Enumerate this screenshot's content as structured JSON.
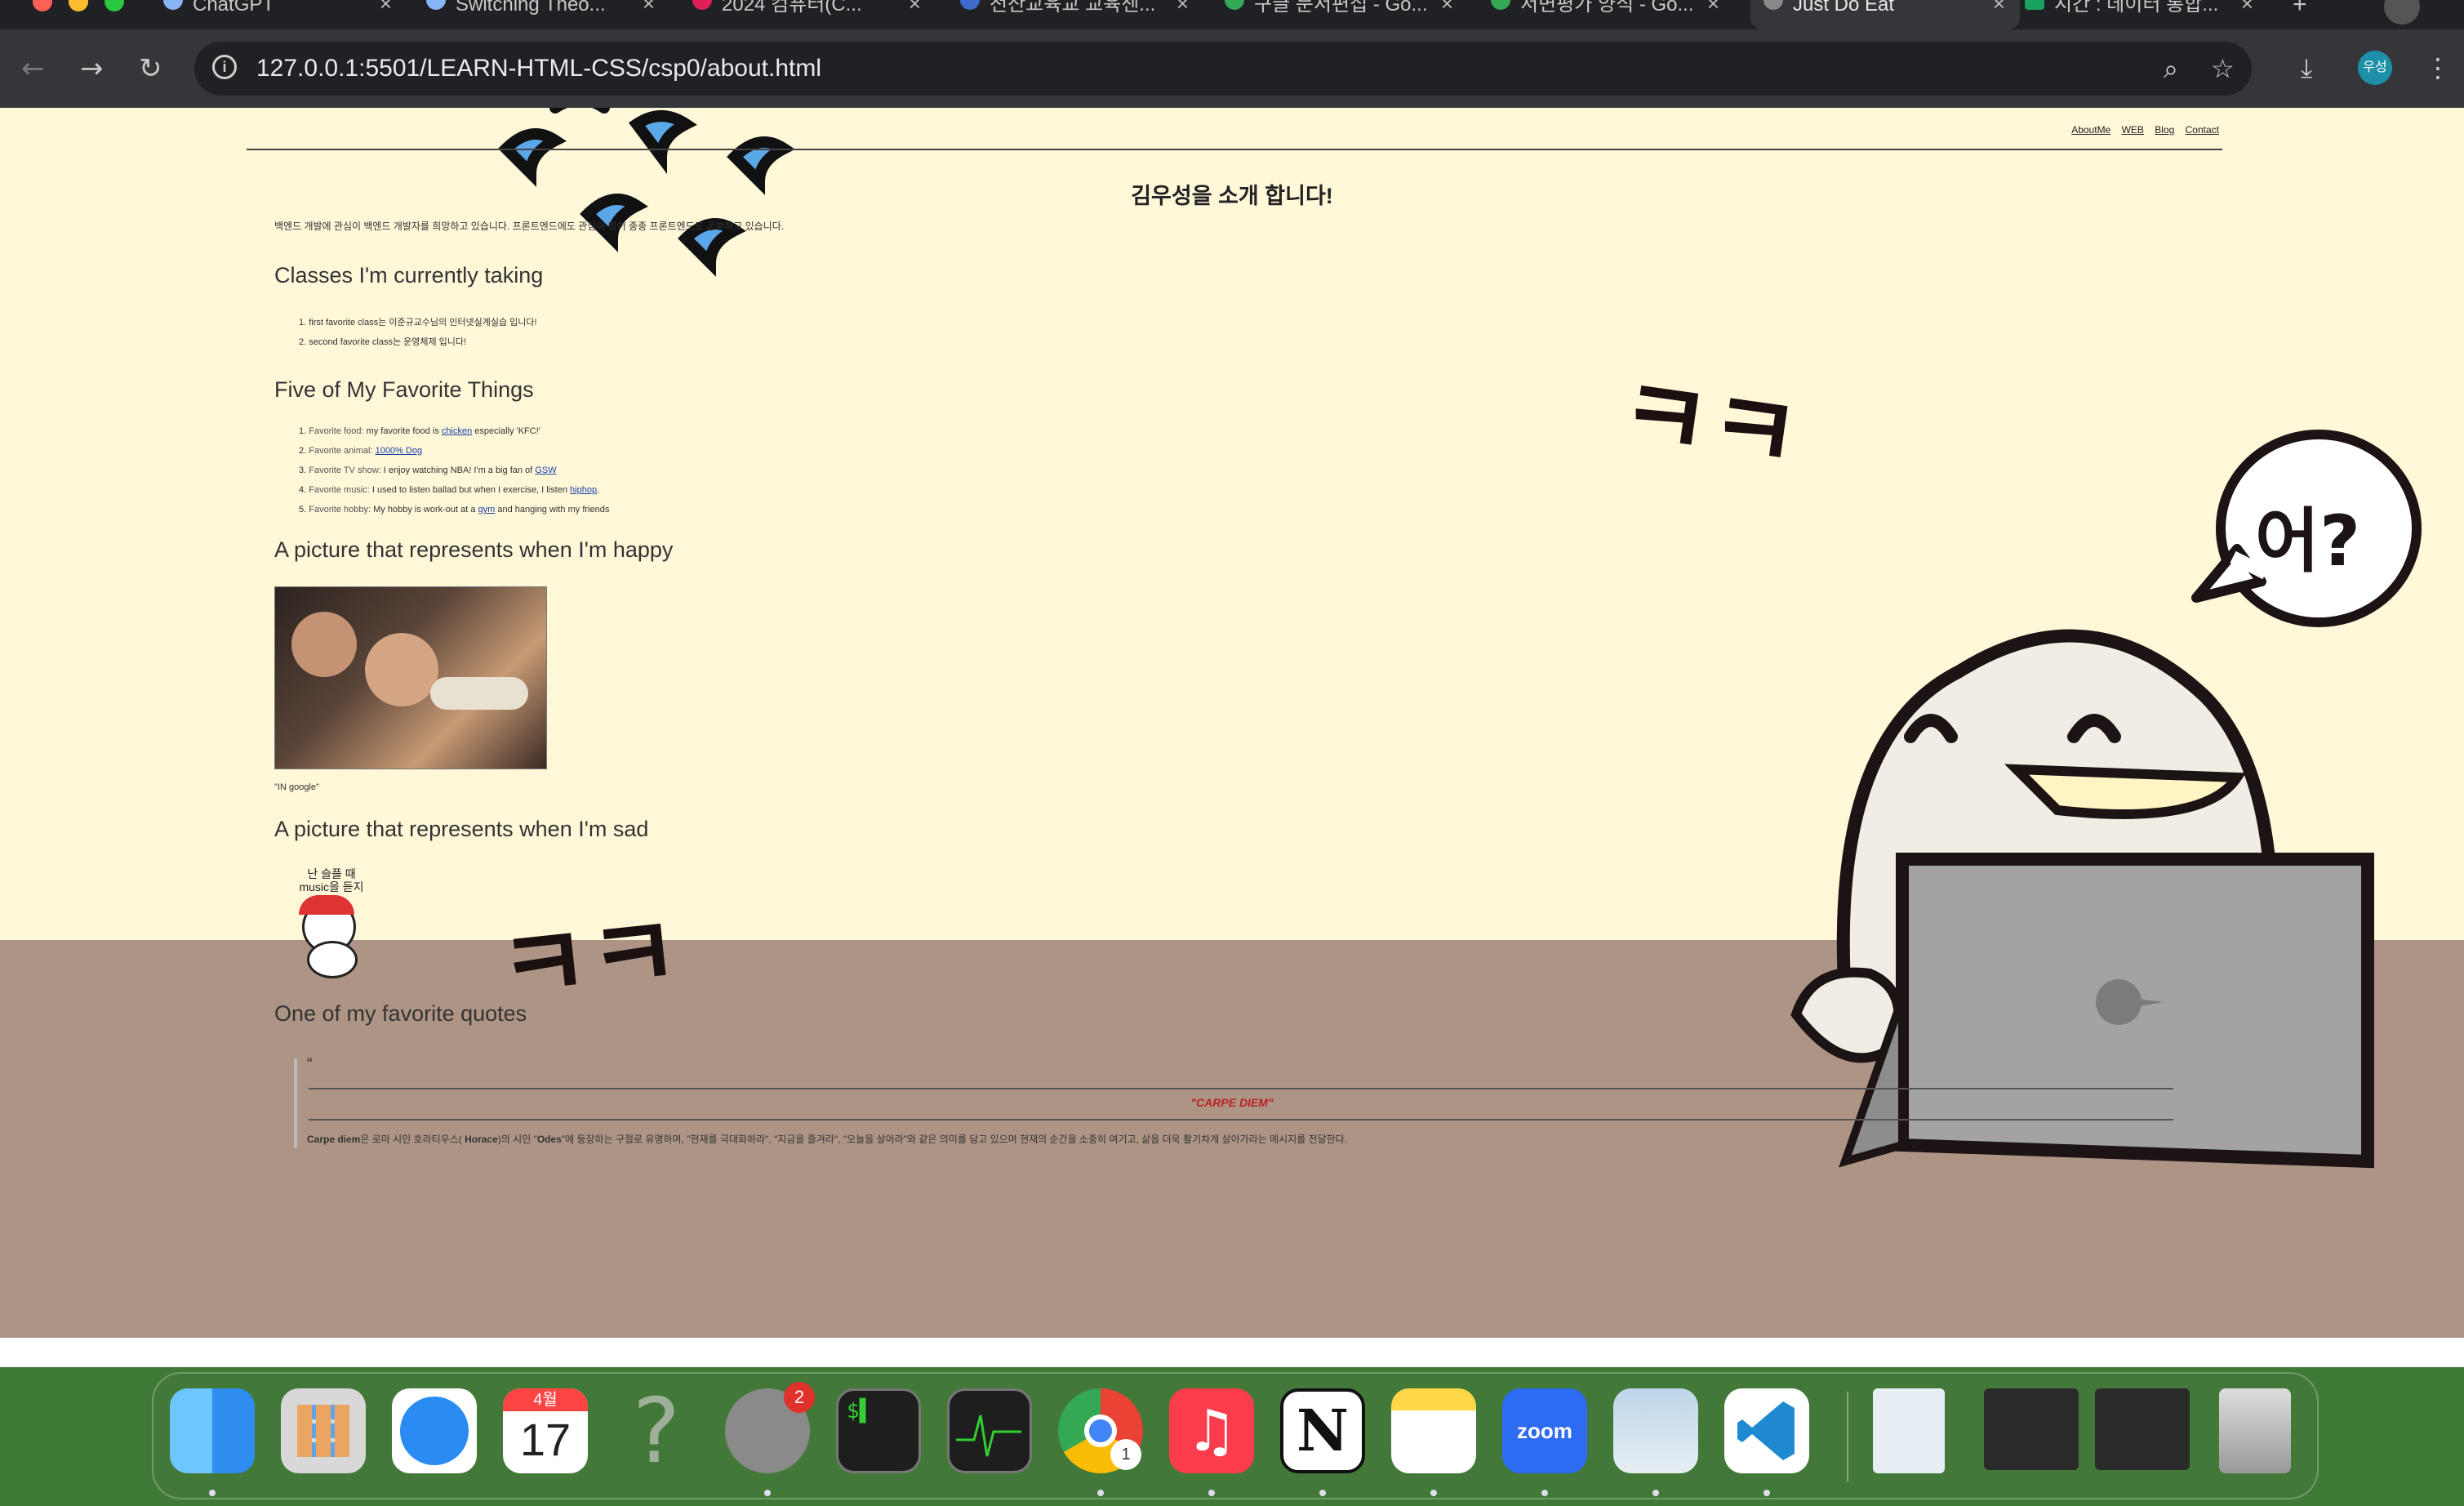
{
  "browser": {
    "tabs": [
      {
        "title": "ChatGPT",
        "active": false
      },
      {
        "title": "Switching Theo...",
        "active": false
      },
      {
        "title": "2024 컴퓨터(C...",
        "active": false
      },
      {
        "title": "전산교육교 교육센...",
        "active": false
      },
      {
        "title": "구글 문서편집 - Go...",
        "active": false
      },
      {
        "title": "서면평가 양식 - Go...",
        "active": false
      },
      {
        "title": "Just Do Eat",
        "active": true
      },
      {
        "title": "시간 : 데이터 통합...",
        "active": false
      }
    ],
    "url": "127.0.0.1:5501/LEARN-HTML-CSS/csp0/about.html",
    "profile_initials": "우성"
  },
  "page": {
    "nav": [
      "AboutMe",
      "WEB",
      "Blog",
      "Contact"
    ],
    "heading": "김우성을 소개 합니다!",
    "intro": "백엔드 개발에 관심이 백엔드 개발자를 희망하고 있습니다. 프론트엔드에도 관심이 있어 종종 프론트엔드도 공부하고 있습니다.",
    "classes_title": "Classes I'm currently taking",
    "classes": [
      "1. first favorite class는 이준규교수님의 인터넷실계실습 입니다!",
      "2. second favorite class는 운영체제 입니다!"
    ],
    "favorites_title": "Five of My Favorite Things",
    "favorites": [
      {
        "num": "1.",
        "label": "Favorite food:",
        "text_before": " my favorite food is ",
        "link": "chicken",
        "text_after": " especially 'KFC!'"
      },
      {
        "num": "2.",
        "label": "Favorite animal:",
        "text_before": " ",
        "link": "1000% Dog",
        "text_after": ""
      },
      {
        "num": "3.",
        "label": "Favorite TV show:",
        "text_before": " I enjoy watching NBA! I'm a big fan of ",
        "link": "GSW",
        "text_after": ""
      },
      {
        "num": "4.",
        "label": "Favorite music:",
        "text_before": " I used to listen ballad but when I exercise, I listen ",
        "link": "hiphop",
        "text_after": "."
      },
      {
        "num": "5.",
        "label": "Favorite hobby:",
        "text_before": " My hobby is work-out at a ",
        "link": "gym",
        "text_after": " and hanging with my friends"
      }
    ],
    "happy_title": "A picture that represents when I'm happy",
    "happy_caption": "\"IN google\"",
    "sad_title": "A picture that represents when I'm sad",
    "sad_sticker_text": "난 슬플 때\nmusic을 듣지",
    "quote_title_section": "One of my favorite quotes",
    "quote_mark": "“",
    "quote_title": "\"CARPE DIEM\"",
    "quote_text_bold1": "Carpe diem",
    "quote_text_1": "은 로마 시인 호라티우스( ",
    "quote_text_bold2": "Horace",
    "quote_text_2": ")의 시인 \"",
    "quote_text_bold3": "Odes",
    "quote_text_3": "\"에 등장하는 구절로 유명하며, \"현재를 극대화하라\", \"지금을 즐겨라\", \"오늘을 살아라\"와 같은 의미를 담고 있으며 현재의 순간을 소중히 여기고, 삶을 더욱 활기차게 살아가라는 메시지를 전달한다.",
    "bubble_text": "어?",
    "doodle_1": "ㅋㅋ",
    "doodle_2": "ㅋㅋ"
  },
  "dock": {
    "apps": [
      {
        "name": "Finder",
        "color": "#2f8cf0"
      },
      {
        "name": "Launchpad",
        "color": "#d8d8d8"
      },
      {
        "name": "Safari",
        "color": "#2a8cf2"
      },
      {
        "name": "Calendar",
        "color": "#ffffff"
      },
      {
        "name": "Help",
        "color": "#6f7f66"
      },
      {
        "name": "System Settings",
        "color": "#8a8a8a"
      },
      {
        "name": "Terminal",
        "color": "#1e1e1e"
      },
      {
        "name": "Activity Monitor",
        "color": "#1e1e1e"
      },
      {
        "name": "Chrome",
        "color": "#ffffff"
      },
      {
        "name": "Music",
        "color": "#fa3c4c"
      },
      {
        "name": "Notion",
        "color": "#ffffff"
      },
      {
        "name": "Notes",
        "color": "#ffd84a"
      },
      {
        "name": "Zoom",
        "color": "#2d6bf2"
      },
      {
        "name": "Preview",
        "color": "#bcd6ea"
      },
      {
        "name": "VS Code",
        "color": "#ffffff"
      },
      {
        "name": "Document",
        "color": "#e8eef5"
      },
      {
        "name": "Window 1",
        "color": "#2b2b2b"
      },
      {
        "name": "Window 2",
        "color": "#2b2b2b"
      },
      {
        "name": "Trash",
        "color": "#c8c8c8"
      }
    ],
    "calendar_month": "4월",
    "calendar_day": "17",
    "settings_badge": "2",
    "chrome_badge": "1",
    "zoom_label": "zoom"
  }
}
